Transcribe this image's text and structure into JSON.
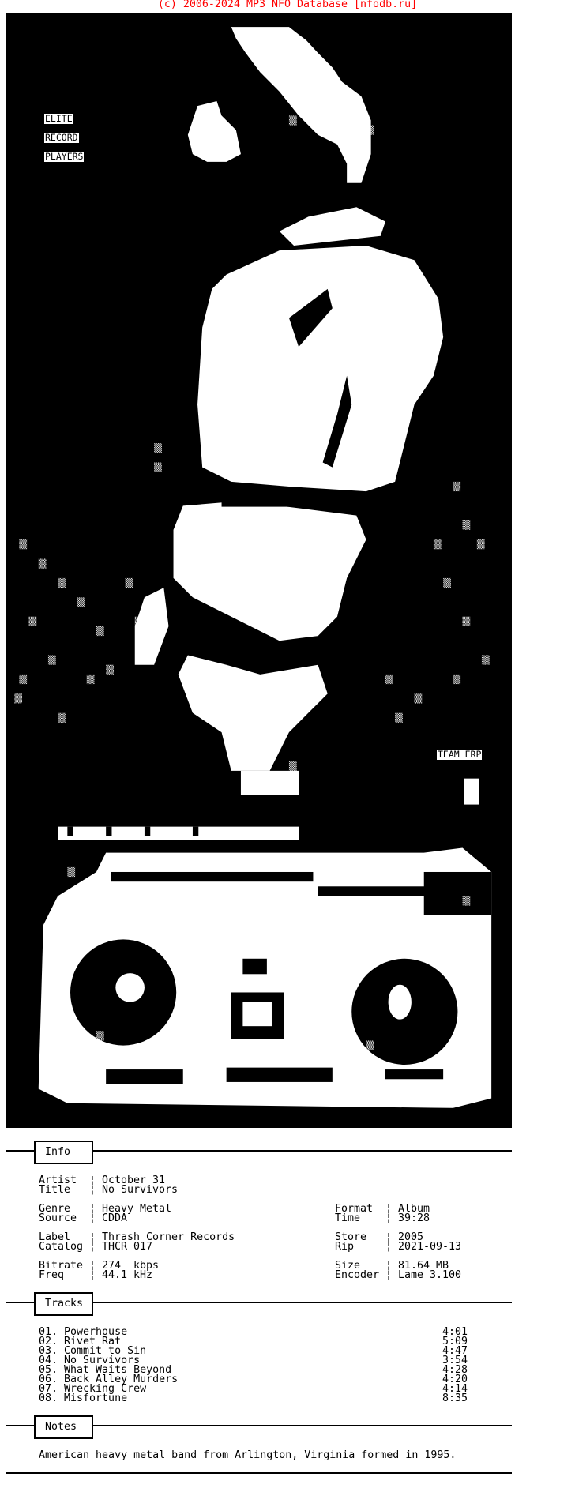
{
  "header": {
    "copyright": "(c) 2006-2024 MP3 NFO Database [nfodb.ru]",
    "color": "#ff0000"
  },
  "art": {
    "labels": [
      "ELITE",
      "RECORD",
      "PLAYERS"
    ],
    "team": "TEAM ERP"
  },
  "sections": {
    "info": "Info",
    "tracks": "Tracks",
    "notes": "Notes"
  },
  "separator": "¦",
  "info": {
    "left": [
      {
        "label": "Artist",
        "value": "October 31"
      },
      {
        "label": "Title",
        "value": "No Survivors"
      },
      {
        "label": "Genre",
        "value": "Heavy Metal"
      },
      {
        "label": "Source",
        "value": "CDDA"
      },
      {
        "label": "Label",
        "value": "Thrash Corner Records"
      },
      {
        "label": "Catalog",
        "value": "THCR 017"
      },
      {
        "label": "Bitrate",
        "value": "274  kbps"
      },
      {
        "label": "Freq",
        "value": "44.1 kHz"
      }
    ],
    "right": [
      {
        "label": "Format",
        "value": "Album"
      },
      {
        "label": "Time",
        "value": "39:28"
      },
      {
        "label": "Store",
        "value": "2005"
      },
      {
        "label": "Rip",
        "value": "2021-09-13"
      },
      {
        "label": "Size",
        "value": "81.64 MB"
      },
      {
        "label": "Encoder",
        "value": "Lame 3.100"
      }
    ]
  },
  "tracks": [
    {
      "title": "01. Powerhouse",
      "duration": "4:01"
    },
    {
      "title": "02. Rivet Rat",
      "duration": "5:09"
    },
    {
      "title": "03. Commit to Sin",
      "duration": "4:47"
    },
    {
      "title": "04. No Survivors",
      "duration": "3:54"
    },
    {
      "title": "05. What Waits Beyond",
      "duration": "4:28"
    },
    {
      "title": "06. Back Alley Murders",
      "duration": "4:20"
    },
    {
      "title": "07. Wrecking Crew",
      "duration": "4:14"
    },
    {
      "title": "08. Misfortune",
      "duration": "8:35"
    }
  ],
  "notes": {
    "text": "American heavy metal band from Arlington, Virginia formed in 1995."
  }
}
